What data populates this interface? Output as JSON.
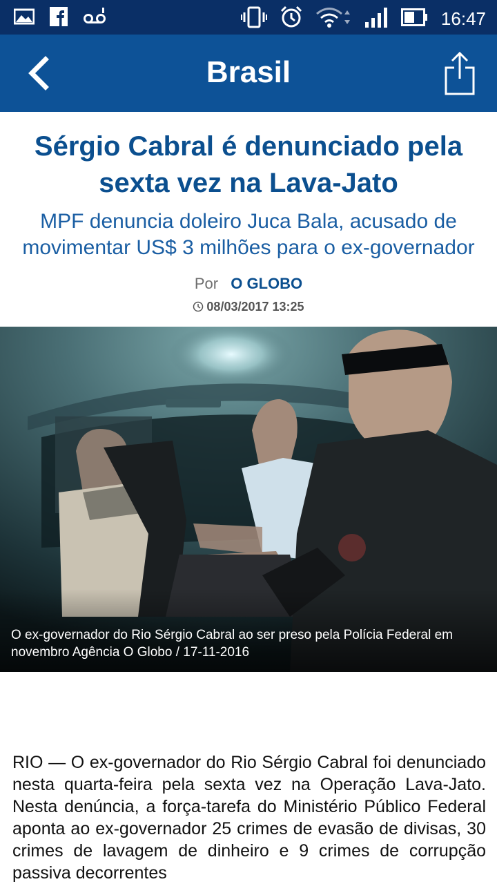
{
  "status_bar": {
    "time": "16:47",
    "icons": [
      "photo-icon",
      "facebook-icon",
      "voicemail-icon",
      "vibrate-icon",
      "alarm-icon",
      "wifi-icon",
      "signal-icon",
      "battery-icon"
    ]
  },
  "app_bar": {
    "title": "Brasil",
    "back_icon": "chevron-left-icon",
    "share_icon": "share-icon",
    "background": "#0d5297"
  },
  "article": {
    "headline": "Sérgio Cabral é denunciado pela sexta vez na Lava-Jato",
    "subheadline": "MPF denuncia doleiro Juca Bala, acusado de movimentar US$ 3 milhões para o ex-governador",
    "byline_prefix": "Por",
    "byline_source": "O GLOBO",
    "date": "08/03/2017 13:25",
    "photo_caption": "O ex-governador do Rio Sérgio Cabral ao ser preso pela Polícia Federal em novembro Agência O Globo / 17-11-2016",
    "body": "RIO — O ex-governador do Rio Sérgio Cabral foi denunciado nesta quarta-feira pela sexta vez na Operação Lava-Jato. Nesta denúncia, a força-tarefa do Ministério Público Federal aponta ao ex-governador 25 crimes de evasão de divisas, 30 crimes de lavagem de dinheiro e 9 crimes de corrupção passiva decorrentes"
  },
  "colors": {
    "status_bar": "#0a2f66",
    "headline": "#0b4f8f",
    "subheadline": "#1a5ea3"
  }
}
